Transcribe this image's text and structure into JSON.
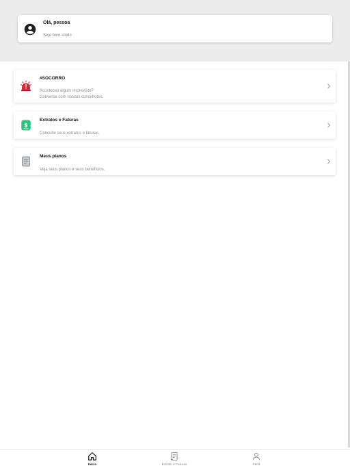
{
  "header": {
    "greeting": "Olá, pessoa",
    "welcome": "Seja bem-vindo"
  },
  "cards": [
    {
      "title": "#SOCORRO",
      "description_lines": [
        "Aconteceu algum imprevisto?",
        "Converse com nossos consultores."
      ],
      "icon": "alarm-icon",
      "icon_color": "#d9263a"
    },
    {
      "title": "Extratos e Faturas",
      "description_lines": [
        "Consulte seus extratos e faturas."
      ],
      "icon": "money-icon",
      "icon_color": "#2ec27e"
    },
    {
      "title": "Meus planos",
      "description_lines": [
        "Veja seus planos e seus benefícios."
      ],
      "icon": "document-icon",
      "icon_color": "#9aa3a8"
    }
  ],
  "bottom_nav": [
    {
      "label": "Início",
      "icon": "home-icon",
      "active": true
    },
    {
      "label": "Extrato e Faturas",
      "icon": "receipt-icon",
      "active": false
    },
    {
      "label": "Perfil",
      "icon": "user-icon",
      "active": false
    }
  ],
  "colors": {
    "header_bg": "#ececec",
    "text_muted": "#8a8a8a",
    "nav_active": "#111111"
  }
}
